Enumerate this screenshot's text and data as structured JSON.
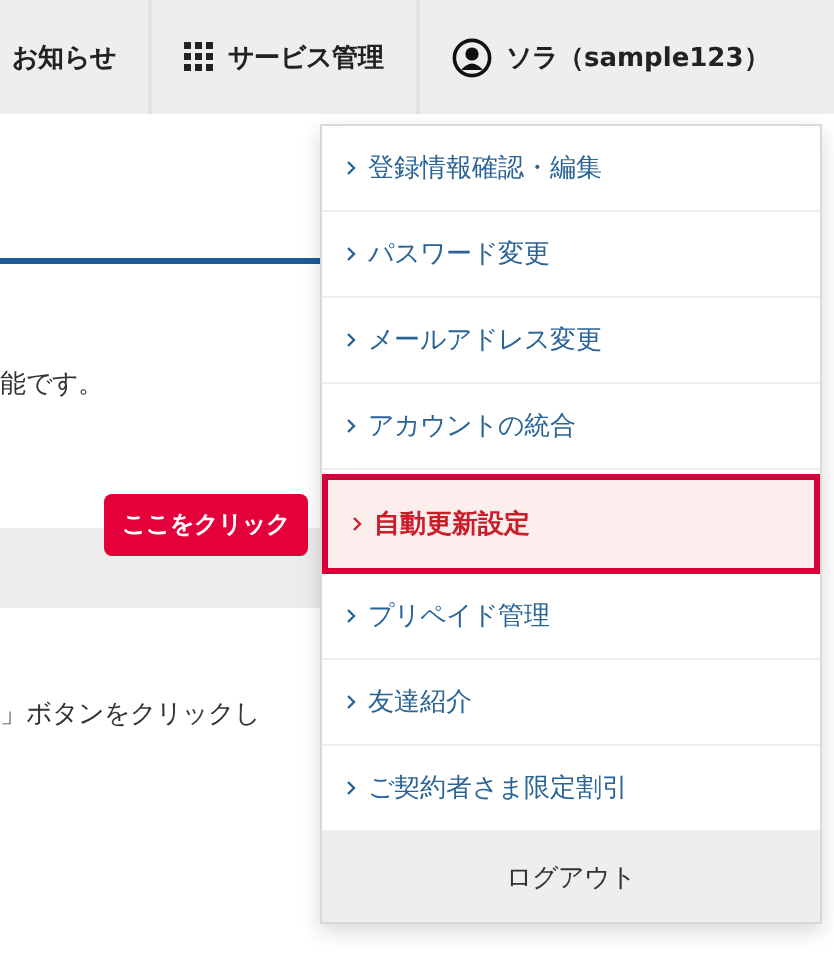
{
  "nav": [
    {
      "label": "お知らせ",
      "kind": "text"
    },
    {
      "label": "サービス管理",
      "kind": "grid"
    },
    {
      "label": "ソラ（sample123）",
      "kind": "user"
    }
  ],
  "content": {
    "text_1": "能です。",
    "button": "ここをクリック",
    "text_2": "」ボタンをクリックし"
  },
  "menu": {
    "items": [
      {
        "label": "登録情報確認・編集",
        "selected": false
      },
      {
        "label": "パスワード変更",
        "selected": false
      },
      {
        "label": "メールアドレス変更",
        "selected": false
      },
      {
        "label": "アカウントの統合",
        "selected": false
      },
      {
        "label": "自動更新設定",
        "selected": true
      },
      {
        "label": "プリペイド管理",
        "selected": false
      },
      {
        "label": "友達紹介",
        "selected": false
      },
      {
        "label": "ご契約者さま限定割引",
        "selected": false
      }
    ],
    "logout": "ログアウト"
  }
}
